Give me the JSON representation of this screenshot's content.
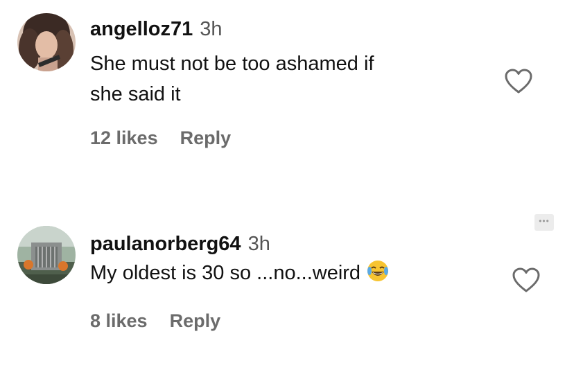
{
  "comments": [
    {
      "username": "angelloz71",
      "time": "3h",
      "text_lines": [
        "She must not be too ashamed if",
        "she said it"
      ],
      "likes": "12 likes",
      "reply_label": "Reply",
      "heart_icon": "heart-outline-icon"
    },
    {
      "username": "paulanorberg64",
      "time": "3h",
      "text_lines": [
        "My oldest is 30 so ...no...weird"
      ],
      "emoji": "😂",
      "likes": "8 likes",
      "reply_label": "Reply",
      "heart_icon": "heart-outline-icon"
    }
  ],
  "more_icon": "ellipsis-icon",
  "colors": {
    "text": "#111111",
    "secondary": "#6b6b6b",
    "timestamp": "#555555"
  }
}
